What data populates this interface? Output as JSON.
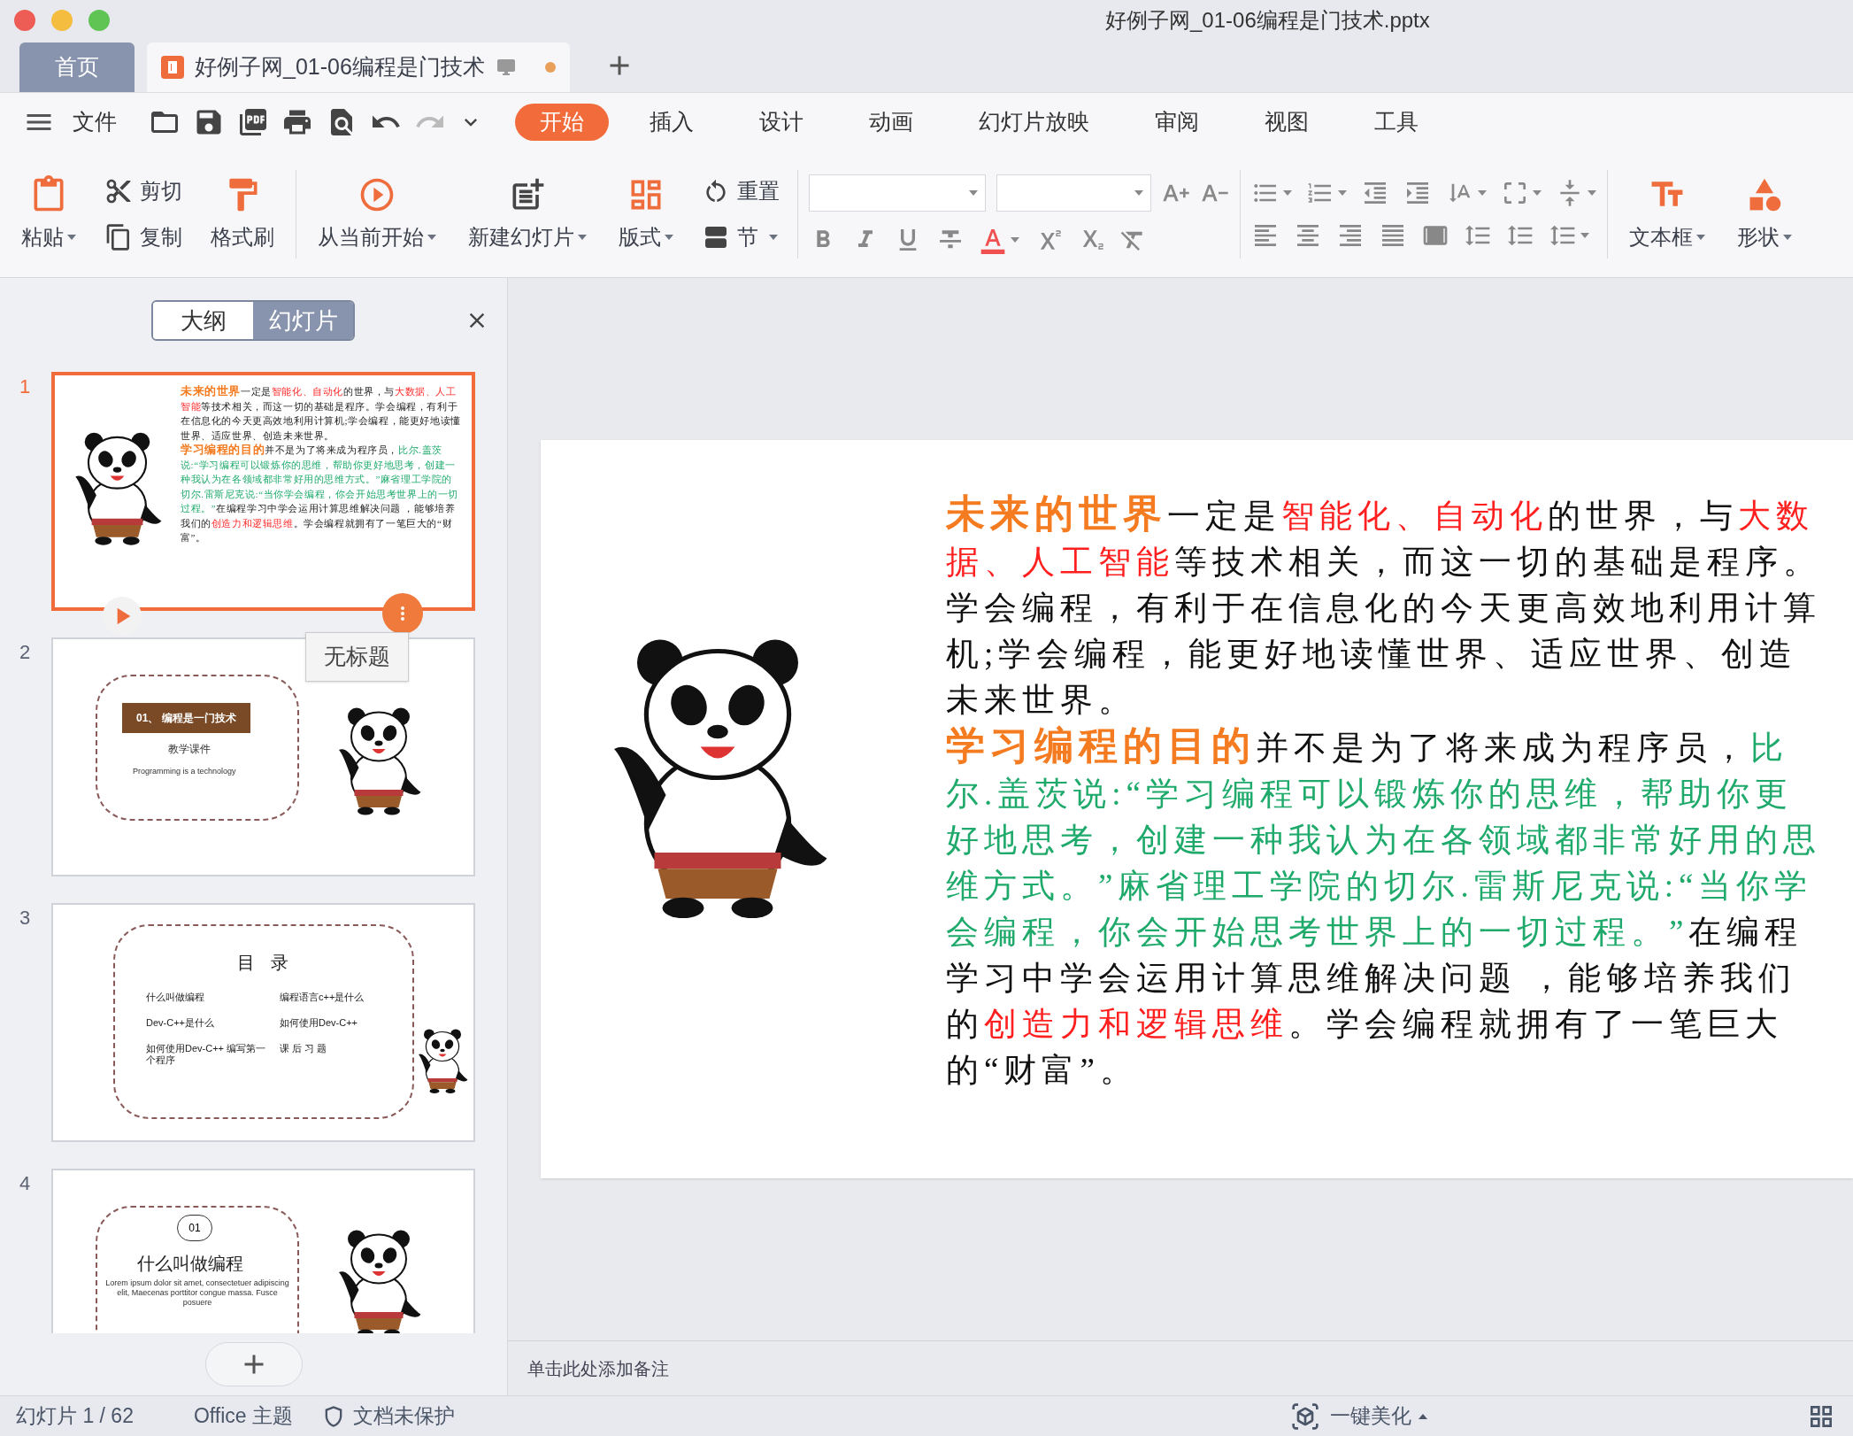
{
  "window": {
    "title": "好例子网_01-06编程是门技术.pptx"
  },
  "tabs": [
    {
      "label": "首页",
      "selected": false,
      "modified": false
    },
    {
      "label": "好例子网_01-06编程是门技术",
      "selected": true,
      "modified": true
    }
  ],
  "menu": {
    "file_label": "文件",
    "tabs": [
      {
        "label": "开始",
        "selected": true
      },
      {
        "label": "插入",
        "selected": false
      },
      {
        "label": "设计",
        "selected": false
      },
      {
        "label": "动画",
        "selected": false
      },
      {
        "label": "幻灯片放映",
        "selected": false
      },
      {
        "label": "审阅",
        "selected": false
      },
      {
        "label": "视图",
        "selected": false
      },
      {
        "label": "工具",
        "selected": false
      }
    ]
  },
  "ribbon": {
    "clipboard": [
      {
        "kind": "large",
        "label": "粘贴",
        "dropdown": true
      },
      {
        "kind": "stack",
        "items": [
          {
            "label": "剪切",
            "dropdown": false
          },
          {
            "label": "复制",
            "dropdown": false
          }
        ]
      },
      {
        "kind": "large",
        "label": "格式刷",
        "dropdown": false
      }
    ],
    "slides": [
      {
        "kind": "large",
        "label": "从当前开始",
        "dropdown": true
      },
      {
        "kind": "large",
        "label": "新建幻灯片",
        "dropdown": true
      },
      {
        "kind": "large",
        "label": "版式",
        "dropdown": true
      },
      {
        "kind": "stack",
        "items": [
          {
            "label": "重置",
            "dropdown": false
          },
          {
            "label": "节",
            "dropdown": true
          }
        ]
      }
    ],
    "insert": [
      {
        "kind": "large",
        "label": "文本框",
        "dropdown": true
      },
      {
        "kind": "large",
        "label": "形状",
        "dropdown": true
      }
    ]
  },
  "panel": {
    "tabs": [
      {
        "label": "大纲",
        "selected": false
      },
      {
        "label": "幻灯片",
        "selected": true
      }
    ],
    "slides": [
      {
        "number": "1",
        "selected": true,
        "kind": "text_panda",
        "paragraphs": [
          [
            {
              "text": "未来的世界",
              "kind": "heading"
            },
            {
              "text": "一定是",
              "kind": "plain"
            },
            {
              "text": "智能化、自动化",
              "kind": "highlight"
            },
            {
              "text": "的世界，与",
              "kind": "plain"
            },
            {
              "text": "大数据、人工智能",
              "kind": "highlight"
            },
            {
              "text": "等技术相关，而这一切的基础是程序。学会编程，有利于在信息化的今天更高效地利用计算机;学会编程，能更好地读懂世界、适应世界、创造未来世界。",
              "kind": "plain"
            }
          ],
          [
            {
              "text": "学习编程的目的",
              "kind": "heading"
            },
            {
              "text": "并不是为了将来成为程序员，",
              "kind": "plain"
            },
            {
              "text": "比尔.盖茨说:“学习编程可以锻炼你的思维，帮助你更好地思考，创建一种我认为在各领域都非常好用的思维方式。”麻省理工学院的切尔.雷斯尼克说:“当你学会编程，你会开始思考世界上的一切过程。”",
              "kind": "quote"
            },
            {
              "text": "在编程学习中学会运用计算思维解决问题 ，能够培养我们的",
              "kind": "plain"
            },
            {
              "text": "创造力和逻辑思维",
              "kind": "highlight"
            },
            {
              "text": "。学会编程就拥有了一笔巨大的“财富”。",
              "kind": "plain"
            }
          ]
        ]
      },
      {
        "number": "2",
        "selected": false,
        "kind": "cover",
        "banner": "01、 编程是一门技术",
        "subtitle": "教学课件",
        "english": "Programming is a technology"
      },
      {
        "number": "3",
        "selected": false,
        "kind": "contents",
        "title": "目 录",
        "items": [
          "什么叫做编程",
          "编程语言c++是什么",
          "Dev-C++是什么",
          "如何使用Dev-C++",
          "如何使用Dev-C++ 编写第一个程序",
          "课 后 习 题"
        ]
      },
      {
        "number": "4",
        "selected": false,
        "kind": "section",
        "badge": "01",
        "title": "什么叫做编程",
        "body": "Lorem ipsum dolor sit amet, consectetuer adipiscing elit, Maecenas porttitor congue massa. Fusce posuere"
      }
    ],
    "tooltip": "无标题"
  },
  "slide": {
    "paragraphs": [
      [
        {
          "text": "未来的世界",
          "kind": "heading"
        },
        {
          "text": "一定是",
          "kind": "plain"
        },
        {
          "text": "智能化、自动化",
          "kind": "highlight"
        },
        {
          "text": "的世界，与",
          "kind": "plain"
        },
        {
          "text": "大数据、人工智能",
          "kind": "highlight"
        },
        {
          "text": "等技术相关，而这一切的基础是程序。学会编程，有利于在信息化的今天更高效地利用计算机;学会编程，能更好地读懂世界、适应世界、创造未来世界。",
          "kind": "plain"
        }
      ],
      [
        {
          "text": "学习编程的目的",
          "kind": "heading"
        },
        {
          "text": "并不是为了将来成为程序员，",
          "kind": "plain"
        },
        {
          "text": "比尔.盖茨说:“学习编程可以锻炼你的思维，帮助你更好地思考，创建一种我认为在各领域都非常好用的思维方式。”麻省理工学院的切尔.雷斯尼克说:“当你学会编程，你会开始思考世界上的一切过程。”",
          "kind": "quote"
        },
        {
          "text": "在编程学习中学会运用计算思维解决问题 ，能够培养我们的",
          "kind": "plain"
        },
        {
          "text": "创造力和逻辑思维",
          "kind": "highlight"
        },
        {
          "text": "。学会编程就拥有了一笔巨大的“财富”。",
          "kind": "plain"
        }
      ]
    ]
  },
  "notes": {
    "placeholder": "单击此处添加备注"
  },
  "status_bar": {
    "slide_count": "幻灯片 1 / 62",
    "theme": "Office 主题",
    "protection": "文档未保护",
    "beautify": "一键美化"
  }
}
